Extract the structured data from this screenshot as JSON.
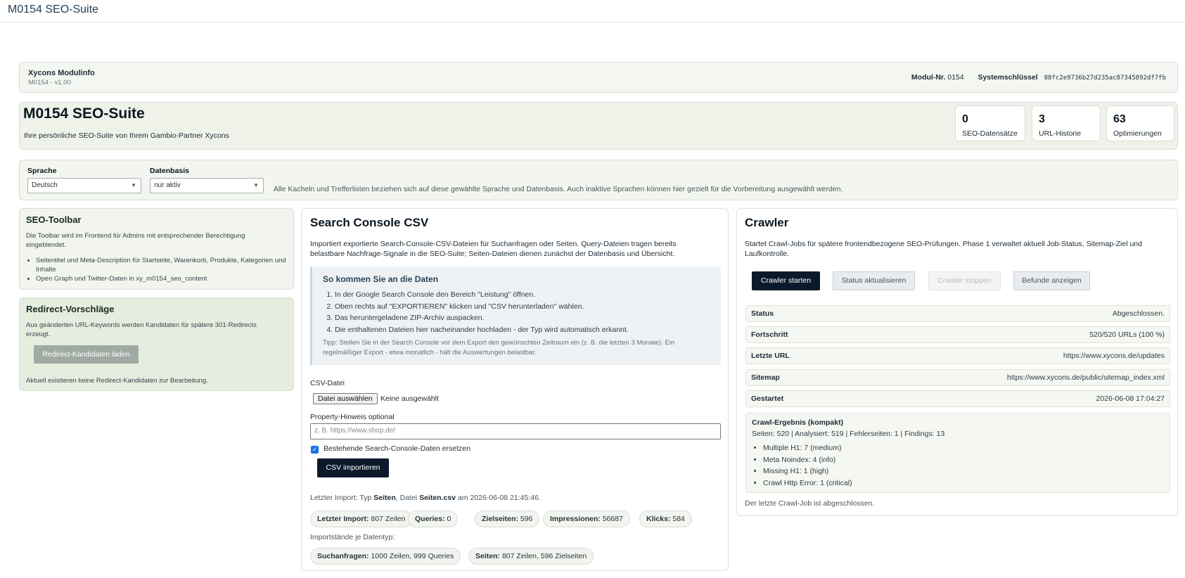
{
  "app": {
    "title": "M0154 SEO-Suite"
  },
  "module_info": {
    "name": "Xycons Modulinfo",
    "version": "M0154 - v1.00",
    "module_nr_label": "Modul-Nr.",
    "module_nr": "0154",
    "system_key_label": "Systemschlüssel",
    "system_key": "88fc2e9736b27d235ac87345892df7fb"
  },
  "hero": {
    "title": "M0154 SEO-Suite",
    "subtitle": "Ihre persönliche SEO-Suite von Ihrem Gambio-Partner Xycons",
    "stats": [
      {
        "value": "0",
        "label": "SEO-Datensätze"
      },
      {
        "value": "3",
        "label": "URL-Historie"
      },
      {
        "value": "63",
        "label": "Optimierungen"
      }
    ]
  },
  "filters": {
    "language_label": "Sprache",
    "language_value": "Deutsch",
    "database_label": "Datenbasis",
    "database_value": "nur aktiv",
    "hint": "Alle Kacheln und Trefferlisten beziehen sich auf diese gewählte Sprache und Datenbasis. Auch inaktive Sprachen können hier gezielt für die Vorbereitung ausgewählt werden."
  },
  "seo_toolbar": {
    "title": "SEO-Toolbar",
    "text": "Die Toolbar wird im Frontend für Admins mit entsprechender Berechtigung eingeblendet.",
    "items": [
      "Seitentitel und Meta-Description für Startseite, Warenkorb, Produkte, Kategorien und Inhalte",
      "Open Graph und Twitter-Daten in xy_m0154_seo_content"
    ]
  },
  "redirects": {
    "title": "Redirect-Vorschläge",
    "text": "Aus geänderten URL-Keywords werden Kandidaten für spätere 301-Redirects erzeugt.",
    "button": "Redirect-Kandidaten laden",
    "empty": "Aktuell existieren keine Redirect-Kandidaten zur Bearbeitung."
  },
  "search_console": {
    "title": "Search Console CSV",
    "intro": "Importiert exportierte Search-Console-CSV-Dateien für Suchanfragen oder Seiten. Query-Dateien tragen bereits belastbare Nachfrage-Signale in die SEO-Suite; Seiten-Dateien dienen zunächst der Datenbasis und Übersicht.",
    "howto_title": "So kommen Sie an die Daten",
    "steps": [
      "In der Google Search Console den Bereich \"Leistung\" öffnen.",
      "Oben rechts auf \"EXPORTIEREN\" klicken und \"CSV herunterladen\" wählen.",
      "Das heruntergeladene ZIP-Archiv auspacken.",
      "Die enthaltenen Dateien hier nacheinander hochladen - der Typ wird automatisch erkannt."
    ],
    "tip": "Tipp: Stellen Sie in der Search Console vor dem Export den gewünschten Zeitraum ein (z. B. die letzten 3 Monate). Ein regelmäßiger Export - etwa monatlich - hält die Auswertungen belastbar.",
    "file_label": "CSV-Datei",
    "file_button": "Datei auswählen",
    "file_none": "Keine ausgewählt",
    "property_label": "Property-Hinweis optional",
    "property_placeholder": "z. B. https://www.shop.de/",
    "replace_label": "Bestehende Search-Console-Daten ersetzen",
    "import_button": "CSV importieren",
    "last_import_pre": "Letzter Import: Typ",
    "last_import_type": "Seiten",
    "last_import_mid": ", Datei",
    "last_import_file": "Seiten.csv",
    "last_import_post": "am 2026-06-08 21:45:46.",
    "pills": [
      {
        "label": "Letzter Import:",
        "value": "807 Zeilen"
      },
      {
        "label": "Queries:",
        "value": "0"
      },
      {
        "label": "Zielseiten:",
        "value": "596"
      },
      {
        "label": "Impressionen:",
        "value": "56687"
      },
      {
        "label": "Klicks:",
        "value": "584"
      }
    ],
    "by_type_label": "Importstände je Datentyp:",
    "type_pills": [
      {
        "label": "Suchanfragen:",
        "value": "1000 Zeilen, 999 Queries"
      },
      {
        "label": "Seiten:",
        "value": "807 Zeilen, 596 Zielseiten"
      }
    ]
  },
  "crawler": {
    "title": "Crawler",
    "intro": "Startet Crawl-Jobs für spätere frontendbezogene SEO-Prüfungen. Phase 1 verwaltet aktuell Job-Status, Sitemap-Ziel und Laufkontrolle.",
    "buttons": {
      "start": "Crawler starten",
      "refresh": "Status aktualisieren",
      "stop": "Crawler stoppen",
      "findings": "Befunde anzeigen"
    },
    "rows": [
      {
        "key": "Status",
        "value": "Abgeschlossen."
      },
      {
        "key": "Fortschritt",
        "value": "520/520 URLs (100 %)"
      },
      {
        "key": "Letzte URL",
        "value": "https://www.xycons.de/updates"
      },
      {
        "key": "Sitemap",
        "value": "https://www.xycons.de/public/sitemap_index.xml"
      },
      {
        "key": "Gestartet",
        "value": "2026-06-08 17:04:27"
      }
    ],
    "result_title": "Crawl-Ergebnis (kompakt)",
    "result_summary": "Seiten: 520 | Analysiert: 519 | Fehlerseiten: 1 | Findings: 13",
    "result_items": [
      "Multiple H1: 7 (medium)",
      "Meta Noindex: 4 (info)",
      "Missing H1: 1 (high)",
      "Crawl Http Error: 1 (critical)"
    ],
    "footer": "Der letzte Crawl-Job ist abgeschlossen."
  }
}
